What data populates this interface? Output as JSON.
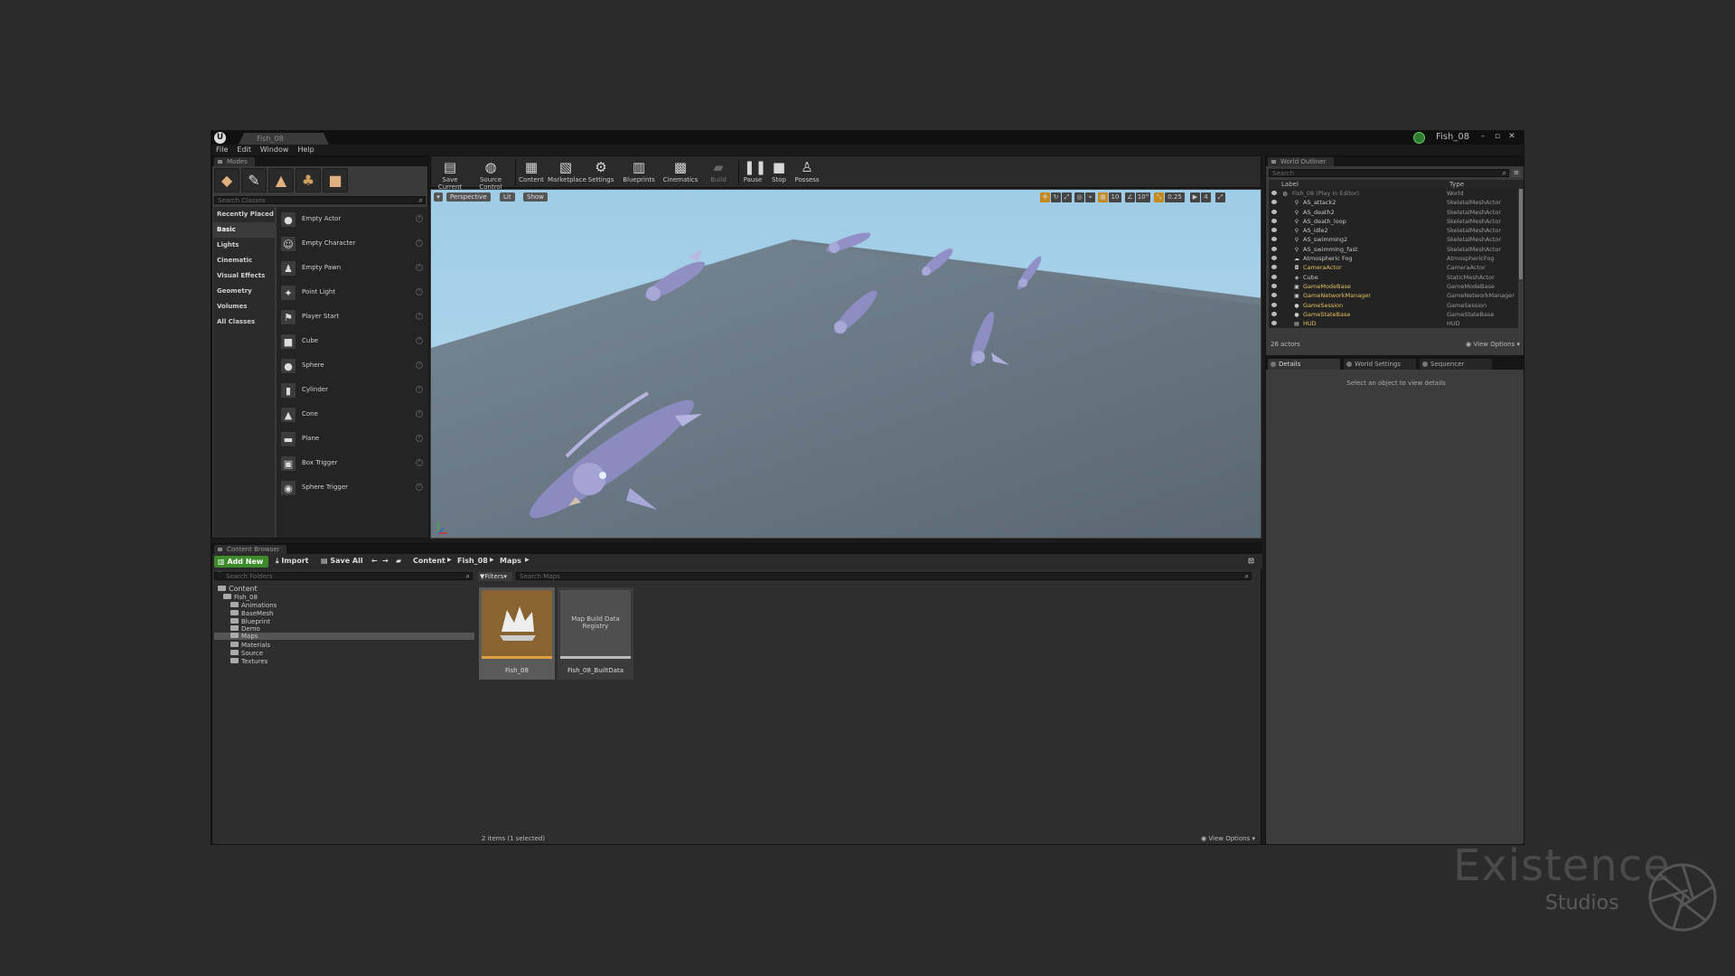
{
  "window": {
    "tab_title": "Fish_08",
    "project_name": "Fish_08",
    "minimize": "–",
    "maximize": "▫",
    "close": "✕"
  },
  "menu": [
    "File",
    "Edit",
    "Window",
    "Help"
  ],
  "modes": {
    "tab": "Modes",
    "search_placeholder": "Search Classes",
    "categories": [
      "Recently Placed",
      "Basic",
      "Lights",
      "Cinematic",
      "Visual Effects",
      "Geometry",
      "Volumes",
      "All Classes"
    ],
    "selected_category": "Basic",
    "items": [
      "Empty Actor",
      "Empty Character",
      "Empty Pawn",
      "Point Light",
      "Player Start",
      "Cube",
      "Sphere",
      "Cylinder",
      "Cone",
      "Plane",
      "Box Trigger",
      "Sphere Trigger"
    ]
  },
  "toolbar": {
    "buttons": [
      "Save Current",
      "Source Control",
      "Content",
      "Marketplace",
      "Settings",
      "Blueprints",
      "Cinematics",
      "Build",
      "Pause",
      "Stop",
      "Possess"
    ]
  },
  "viewport": {
    "perspective": "Perspective",
    "lit": "Lit",
    "show": "Show",
    "grid_snap": "10",
    "rotation_snap": "10°",
    "scale_snap": "0.25",
    "camera_speed": "4",
    "sky_color": "#a9cfe4",
    "floor_color": "#6f7d89"
  },
  "outliner": {
    "tab": "World Outliner",
    "search_placeholder": "Search",
    "col_label": "Label",
    "col_type": "Type",
    "rows": [
      {
        "label": "Fish_08 (Play In Editor)",
        "type": "World"
      },
      {
        "label": "AS_attack2",
        "type": "SkeletalMeshActor"
      },
      {
        "label": "AS_death2",
        "type": "SkeletalMeshActor"
      },
      {
        "label": "AS_death_loop",
        "type": "SkeletalMeshActor"
      },
      {
        "label": "AS_idle2",
        "type": "SkeletalMeshActor"
      },
      {
        "label": "AS_swimming2",
        "type": "SkeletalMeshActor"
      },
      {
        "label": "AS_swimming_fast",
        "type": "SkeletalMeshActor"
      },
      {
        "label": "Atmospheric Fog",
        "type": "AtmosphericFog"
      },
      {
        "label": "CameraActor",
        "type": "CameraActor"
      },
      {
        "label": "Cube",
        "type": "StaticMeshActor"
      },
      {
        "label": "GameModeBase",
        "type": "GameModeBase"
      },
      {
        "label": "GameNetworkManager",
        "type": "GameNetworkManager"
      },
      {
        "label": "GameSession",
        "type": "GameSession"
      },
      {
        "label": "GameStateBase",
        "type": "GameStateBase"
      },
      {
        "label": "HUD",
        "type": "HUD"
      }
    ],
    "count": "26 actors",
    "view_options": "View Options"
  },
  "details": {
    "tabs": [
      "Details",
      "World Settings",
      "Sequencer"
    ],
    "hint": "Select an object to view details"
  },
  "content_browser": {
    "tab": "Content Browser",
    "add_new": "Add New",
    "import": "Import",
    "save_all": "Save All",
    "breadcrumb": [
      "Content",
      "Fish_08",
      "Maps"
    ],
    "search_folders_placeholder": "Search Folders",
    "filters": "Filters",
    "search_maps_placeholder": "Search Maps",
    "tree": [
      "Content",
      "Fish_08",
      "Animations",
      "BaseMesh",
      "Blueprint",
      "Demo",
      "Maps",
      "Materials",
      "Source",
      "Textures"
    ],
    "assets": [
      {
        "name": "Fish_08",
        "thumb_text": "",
        "bar_color": "#e0a040"
      },
      {
        "name": "Fish_08_BuiltData",
        "thumb_text": "Map Build Data Registry",
        "bar_color": "#bbbbbb"
      }
    ],
    "status": "2 items (1 selected)",
    "view_options": "View Options"
  },
  "brand": {
    "name": "Existence",
    "sub": "Studios"
  }
}
